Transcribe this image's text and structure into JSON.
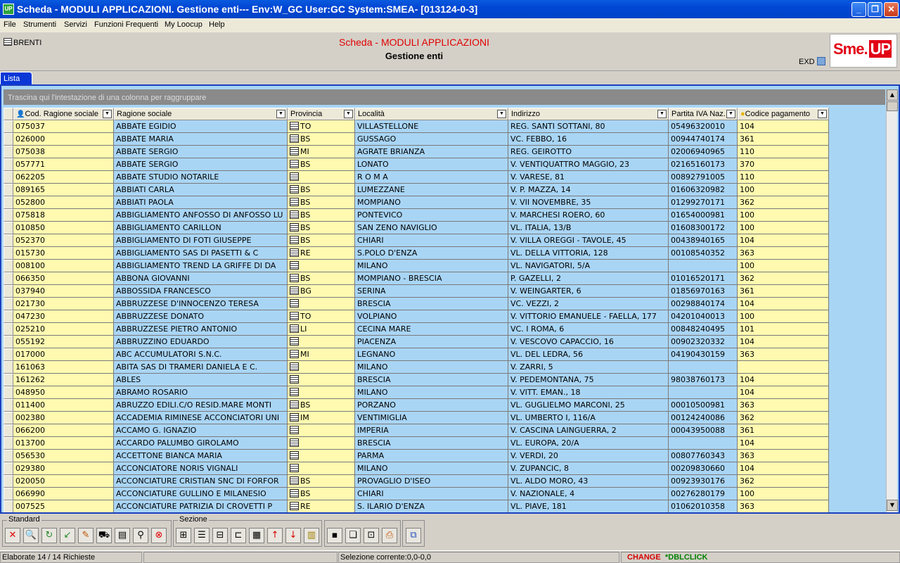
{
  "window": {
    "title": "Scheda - MODULI APPLICAZIONI. Gestione enti--- Env:W_GC User:GC System:SMEA- [013124-0-3]",
    "app_icon": "UP"
  },
  "menu": [
    "File",
    "Strumenti",
    "Servizi",
    "Funzioni Frequenti",
    "My Loocup",
    "Help"
  ],
  "header": {
    "left_label": "BRENTI",
    "title": "Scheda - MODULI APPLICAZIONI",
    "subtitle": "Gestione enti",
    "exd": "EXD",
    "logo_text": "Sme.",
    "logo_accent": "UP"
  },
  "tabs": [
    {
      "label": "Lista"
    }
  ],
  "grid": {
    "group_hint": "Trascina qui l'intestazione di una colonna per raggruppare",
    "columns": [
      "Cod. Ragione sociale",
      "Ragione sociale",
      "Provincia",
      "Località",
      "Indirizzo",
      "Partita IVA Naz.",
      "Codice pagamento"
    ],
    "rows": [
      [
        "075037",
        "ABBATE EGIDIO",
        "TO",
        "VILLASTELLONE",
        "REG. SANTI SOTTANI, 80",
        "05496320010",
        "104"
      ],
      [
        "026000",
        "ABBATE MARIA",
        "BS",
        "GUSSAGO",
        "VC. FEBBO, 16",
        "00944740174",
        "361"
      ],
      [
        "075038",
        "ABBATE SERGIO",
        "MI",
        "AGRATE BRIANZA",
        "REG. GEIROTTO",
        "02006940965",
        "110"
      ],
      [
        "057771",
        "ABBATE SERGIO",
        "BS",
        "LONATO",
        "V. VENTIQUATTRO MAGGIO, 23",
        "02165160173",
        "370"
      ],
      [
        "062205",
        "ABBATE STUDIO NOTARILE",
        "",
        "R O M A",
        "V. VARESE, 81",
        "00892791005",
        "110"
      ],
      [
        "089165",
        "ABBIATI CARLA",
        "BS",
        "LUMEZZANE",
        "V. P. MAZZA, 14",
        "01606320982",
        "100"
      ],
      [
        "052800",
        "ABBIATI PAOLA",
        "BS",
        "MOMPIANO",
        "V. VII NOVEMBRE, 35",
        "01299270171",
        "362"
      ],
      [
        "075818",
        "ABBIGLIAMENTO ANFOSSO DI ANFOSSO LU",
        "BS",
        "PONTEVICO",
        "V. MARCHESI ROERO, 60",
        "01654000981",
        "100"
      ],
      [
        "010850",
        "ABBIGLIAMENTO CARILLON",
        "BS",
        "SAN ZENO NAVIGLIO",
        "VL. ITALIA, 13/B",
        "01608300172",
        "100"
      ],
      [
        "052370",
        "ABBIGLIAMENTO DI FOTI GIUSEPPE",
        "BS",
        "CHIARI",
        "V. VILLA OREGGI - TAVOLE, 45",
        "00438940165",
        "104"
      ],
      [
        "015730",
        "ABBIGLIAMENTO SAS DI PASETTI & C",
        "RE",
        "S.POLO D'ENZA",
        "VL. DELLA VITTORIA, 128",
        "00108540352",
        "363"
      ],
      [
        "008100",
        "ABBIGLIAMENTO TREND LA GRIFFE DI DA",
        "",
        "MILANO",
        "VL. NAVIGATORI, 5/A",
        "",
        "100"
      ],
      [
        "066350",
        "ABBONA GIOVANNI",
        "BS",
        "MOMPIANO - BRESCIA",
        "P. GAZELLI, 2",
        "01016520171",
        "362"
      ],
      [
        "037940",
        "ABBOSSIDA FRANCESCO",
        "BG",
        "SERINA",
        "V. WEINGARTER, 6",
        "01856970163",
        "361"
      ],
      [
        "021730",
        "ABBRUZZESE D'INNOCENZO TERESA",
        "",
        "BRESCIA",
        "VC. VEZZI, 2",
        "00298840174",
        "104"
      ],
      [
        "047230",
        "ABBRUZZESE DONATO",
        "TO",
        "VOLPIANO",
        "V. VITTORIO EMANUELE - FAELLA, 177",
        "04201040013",
        "100"
      ],
      [
        "025210",
        "ABBRUZZESE PIETRO ANTONIO",
        "LI",
        "CECINA MARE",
        "VC. I ROMA, 6",
        "00848240495",
        "101"
      ],
      [
        "055192",
        "ABBRUZZINO EDUARDO",
        "",
        "PIACENZA",
        "V. VESCOVO CAPACCIO, 16",
        "00902320332",
        "104"
      ],
      [
        "017000",
        "ABC ACCUMULATORI S.N.C.",
        "MI",
        "LEGNANO",
        "VL. DEL LEDRA, 56",
        "04190430159",
        "363"
      ],
      [
        "161063",
        "ABITA SAS DI TRAMERI DANIELA E C.",
        "",
        "MILANO",
        "V. ZARRI, 5",
        "",
        ""
      ],
      [
        "161262",
        "ABLES",
        "",
        "BRESCIA",
        "V. PEDEMONTANA, 75",
        "98038760173",
        "104"
      ],
      [
        "048950",
        "ABRAMO ROSARIO",
        "",
        "MILANO",
        "V. VITT. EMAN., 18",
        "",
        "104"
      ],
      [
        "011400",
        "ABRUZZO EDILI.C/O RESID.MARE MONTI",
        "BS",
        "PORZANO",
        "VL. GUGLIELMO MARCONI, 25",
        "00010500981",
        "363"
      ],
      [
        "002380",
        "ACCADEMIA RIMINESE ACCONCIATORI UNI",
        "IM",
        "VENTIMIGLIA",
        "VL. UMBERTO I, 116/A",
        "00124240086",
        "362"
      ],
      [
        "066200",
        "ACCAMO G. IGNAZIO",
        "",
        "IMPERIA",
        "V. CASCINA LAINGUERRA, 2",
        "00043950088",
        "361"
      ],
      [
        "013700",
        "ACCARDO PALUMBO GIROLAMO",
        "",
        "BRESCIA",
        "VL. EUROPA, 20/A",
        "",
        "104"
      ],
      [
        "056530",
        "ACCETTONE BIANCA MARIA",
        "",
        "PARMA",
        "V. VERDI, 20",
        "00807760343",
        "363"
      ],
      [
        "029380",
        "ACCONCIATORE NORIS VIGNALI",
        "",
        "MILANO",
        "V. ZUPANCIC, 8",
        "00209830660",
        "104"
      ],
      [
        "020050",
        "ACCONCIATURE CRISTIAN SNC DI FORFOR",
        "BS",
        "PROVAGLIO D'ISEO",
        "VL. ALDO MORO, 43",
        "00923930176",
        "362"
      ],
      [
        "066990",
        "ACCONCIATURE GULLINO E MILANESIO",
        "BS",
        "CHIARI",
        "V. NAZIONALE, 4",
        "00276280179",
        "100"
      ],
      [
        "007525",
        "ACCONCIATURE PATRIZIA DI CROVETTI P",
        "RE",
        "S. ILARIO D'ENZA",
        "VL. PIAVE, 181",
        "01062010358",
        "363"
      ]
    ]
  },
  "toolbar": {
    "group1": "Standard",
    "group2": "Sezione"
  },
  "status": {
    "left": "Elaborate 14 / 14 Richieste",
    "mid": "Selezione corrente:0,0-0,0",
    "change": "CHANGE",
    "dbl": "*DBLCLICK"
  },
  "colors": {
    "yellow": "#fffab0",
    "blue": "#a9d5f5",
    "change": "#d40000",
    "dbl": "#008000"
  }
}
